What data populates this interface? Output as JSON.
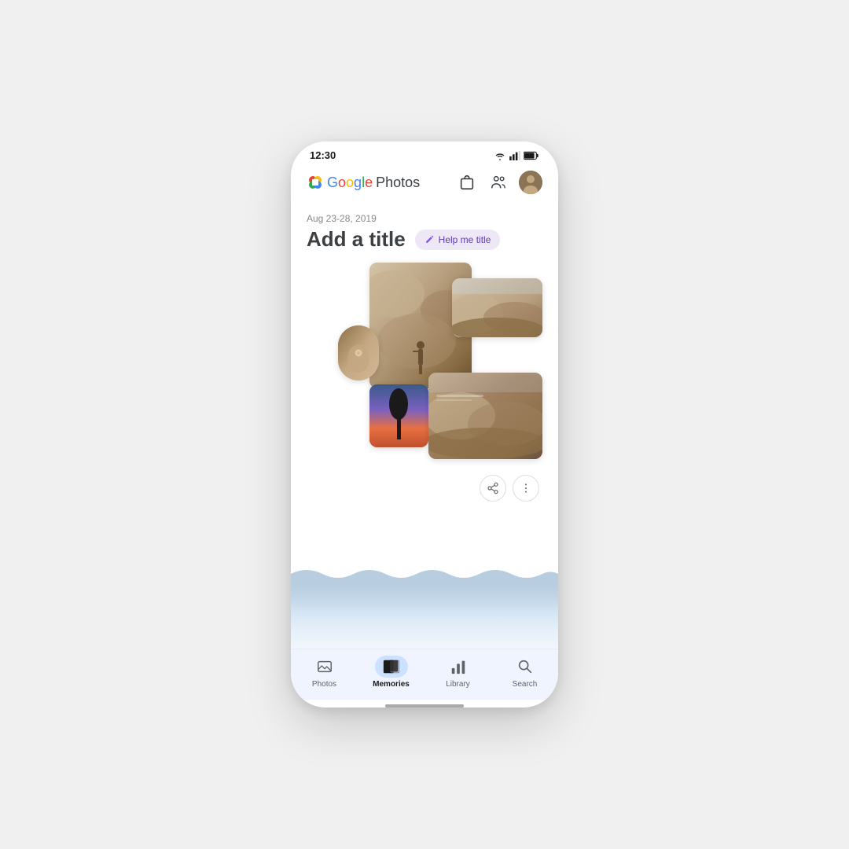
{
  "status": {
    "time": "12:30"
  },
  "header": {
    "logo_google": "Google",
    "logo_photos": "Photos",
    "shop_icon": "shopping-bag-icon",
    "people_icon": "people-icon",
    "avatar_icon": "avatar-icon"
  },
  "memory": {
    "date_range": "Aug 23-28, 2019",
    "title_placeholder": "Add a title",
    "help_btn_label": "Help me title",
    "pen_icon": "pen-icon"
  },
  "actions": {
    "share_icon": "share-icon",
    "more_icon": "more-options-icon"
  },
  "nav": {
    "items": [
      {
        "id": "photos",
        "label": "Photos",
        "active": false
      },
      {
        "id": "memories",
        "label": "Memories",
        "active": true
      },
      {
        "id": "library",
        "label": "Library",
        "active": false
      },
      {
        "id": "search",
        "label": "Search",
        "active": false
      }
    ]
  },
  "colors": {
    "help_btn_bg": "#EDE7F6",
    "help_btn_text": "#5B3DB0",
    "nav_active_bg": "#CCE0FF",
    "nav_active_label": "#1a1a1a"
  }
}
